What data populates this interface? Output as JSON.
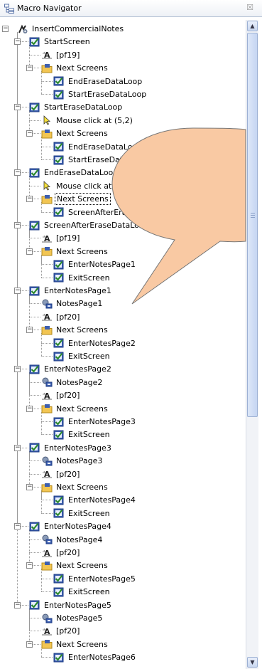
{
  "panel": {
    "title": "Macro Navigator",
    "close_glyph": "☒"
  },
  "tree": [
    {
      "label": "InsertCommercialNotes",
      "icon": "macro-icon",
      "expander": "minus"
    },
    {
      "label": "StartScreen",
      "icon": "screen-check-icon",
      "expander": "minus"
    },
    {
      "label": "[pf19]",
      "icon": "input-key-icon",
      "expander": null
    },
    {
      "label": "Next Screens",
      "icon": "folder-icon",
      "expander": "minus"
    },
    {
      "label": "EndEraseDataLoop",
      "icon": "screen-check-icon",
      "expander": null
    },
    {
      "label": "StartEraseDataLoop",
      "icon": "screen-check-icon",
      "expander": null
    },
    {
      "label": "StartEraseDataLoop",
      "icon": "screen-check-icon",
      "expander": "minus"
    },
    {
      "label": "Mouse click at (5,2)",
      "icon": "mouse-pointer-icon",
      "expander": null
    },
    {
      "label": "Next Screens",
      "icon": "folder-icon",
      "expander": "minus"
    },
    {
      "label": "EndEraseDataLoop",
      "icon": "screen-check-icon",
      "expander": null
    },
    {
      "label": "StartEraseDataLoop",
      "icon": "screen-check-icon",
      "expander": null
    },
    {
      "label": "EndEraseDataLoop",
      "icon": "screen-check-icon",
      "expander": "minus"
    },
    {
      "label": "Mouse click at (5,2)",
      "icon": "mouse-pointer-icon",
      "expander": null
    },
    {
      "label": "Next Screens",
      "icon": "folder-icon",
      "expander": "minus",
      "selected": true
    },
    {
      "label": "ScreenAfterEraseDataLoop",
      "icon": "screen-check-icon",
      "expander": null
    },
    {
      "label": "ScreenAfterEraseDataLoop",
      "icon": "screen-check-icon",
      "expander": "minus"
    },
    {
      "label": "[pf19]",
      "icon": "input-key-icon",
      "expander": null
    },
    {
      "label": "Next Screens",
      "icon": "folder-icon",
      "expander": "minus"
    },
    {
      "label": "EnterNotesPage1",
      "icon": "screen-check-icon",
      "expander": null
    },
    {
      "label": "ExitScreen",
      "icon": "screen-check-icon",
      "expander": null
    },
    {
      "label": "EnterNotesPage1",
      "icon": "screen-check-icon",
      "expander": "minus"
    },
    {
      "label": "NotesPage1",
      "icon": "extract-icon",
      "expander": null
    },
    {
      "label": "[pf20]",
      "icon": "input-key-icon",
      "expander": null
    },
    {
      "label": "Next Screens",
      "icon": "folder-icon",
      "expander": "minus"
    },
    {
      "label": "EnterNotesPage2",
      "icon": "screen-check-icon",
      "expander": null
    },
    {
      "label": "ExitScreen",
      "icon": "screen-check-icon",
      "expander": null
    },
    {
      "label": "EnterNotesPage2",
      "icon": "screen-check-icon",
      "expander": "minus"
    },
    {
      "label": "NotesPage2",
      "icon": "extract-icon",
      "expander": null
    },
    {
      "label": "[pf20]",
      "icon": "input-key-icon",
      "expander": null
    },
    {
      "label": "Next Screens",
      "icon": "folder-icon",
      "expander": "minus"
    },
    {
      "label": "EnterNotesPage3",
      "icon": "screen-check-icon",
      "expander": null
    },
    {
      "label": "ExitScreen",
      "icon": "screen-check-icon",
      "expander": null
    },
    {
      "label": "EnterNotesPage3",
      "icon": "screen-check-icon",
      "expander": "minus"
    },
    {
      "label": "NotesPage3",
      "icon": "extract-icon",
      "expander": null
    },
    {
      "label": "[pf20]",
      "icon": "input-key-icon",
      "expander": null
    },
    {
      "label": "Next Screens",
      "icon": "folder-icon",
      "expander": "minus"
    },
    {
      "label": "EnterNotesPage4",
      "icon": "screen-check-icon",
      "expander": null
    },
    {
      "label": "ExitScreen",
      "icon": "screen-check-icon",
      "expander": null
    },
    {
      "label": "EnterNotesPage4",
      "icon": "screen-check-icon",
      "expander": "minus"
    },
    {
      "label": "NotesPage4",
      "icon": "extract-icon",
      "expander": null
    },
    {
      "label": "[pf20]",
      "icon": "input-key-icon",
      "expander": null
    },
    {
      "label": "Next Screens",
      "icon": "folder-icon",
      "expander": "minus"
    },
    {
      "label": "EnterNotesPage5",
      "icon": "screen-check-icon",
      "expander": null
    },
    {
      "label": "ExitScreen",
      "icon": "screen-check-icon",
      "expander": null
    },
    {
      "label": "EnterNotesPage5",
      "icon": "screen-check-icon",
      "expander": "minus"
    },
    {
      "label": "NotesPage5",
      "icon": "extract-icon",
      "expander": null
    },
    {
      "label": "[pf20]",
      "icon": "input-key-icon",
      "expander": null
    },
    {
      "label": "Next Screens",
      "icon": "folder-icon",
      "expander": "minus"
    },
    {
      "label": "EnterNotesPage6",
      "icon": "screen-check-icon",
      "expander": null
    }
  ],
  "scrollbar": {
    "up_glyph": "▲",
    "down_glyph": "▼"
  },
  "colors": {
    "callout_fill": "#f9c9a3",
    "callout_stroke": "#777777",
    "screen_icon": "#3d5fb0",
    "check": "#2c8a2c",
    "folder": "#f2c552"
  }
}
